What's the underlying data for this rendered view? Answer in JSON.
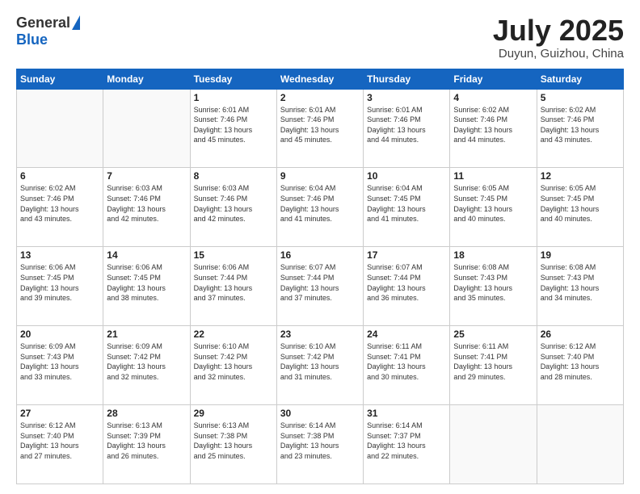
{
  "header": {
    "logo_general": "General",
    "logo_blue": "Blue",
    "title": "July 2025",
    "location": "Duyun, Guizhou, China"
  },
  "weekdays": [
    "Sunday",
    "Monday",
    "Tuesday",
    "Wednesday",
    "Thursday",
    "Friday",
    "Saturday"
  ],
  "weeks": [
    [
      {
        "day": "",
        "info": ""
      },
      {
        "day": "",
        "info": ""
      },
      {
        "day": "1",
        "info": "Sunrise: 6:01 AM\nSunset: 7:46 PM\nDaylight: 13 hours\nand 45 minutes."
      },
      {
        "day": "2",
        "info": "Sunrise: 6:01 AM\nSunset: 7:46 PM\nDaylight: 13 hours\nand 45 minutes."
      },
      {
        "day": "3",
        "info": "Sunrise: 6:01 AM\nSunset: 7:46 PM\nDaylight: 13 hours\nand 44 minutes."
      },
      {
        "day": "4",
        "info": "Sunrise: 6:02 AM\nSunset: 7:46 PM\nDaylight: 13 hours\nand 44 minutes."
      },
      {
        "day": "5",
        "info": "Sunrise: 6:02 AM\nSunset: 7:46 PM\nDaylight: 13 hours\nand 43 minutes."
      }
    ],
    [
      {
        "day": "6",
        "info": "Sunrise: 6:02 AM\nSunset: 7:46 PM\nDaylight: 13 hours\nand 43 minutes."
      },
      {
        "day": "7",
        "info": "Sunrise: 6:03 AM\nSunset: 7:46 PM\nDaylight: 13 hours\nand 42 minutes."
      },
      {
        "day": "8",
        "info": "Sunrise: 6:03 AM\nSunset: 7:46 PM\nDaylight: 13 hours\nand 42 minutes."
      },
      {
        "day": "9",
        "info": "Sunrise: 6:04 AM\nSunset: 7:46 PM\nDaylight: 13 hours\nand 41 minutes."
      },
      {
        "day": "10",
        "info": "Sunrise: 6:04 AM\nSunset: 7:45 PM\nDaylight: 13 hours\nand 41 minutes."
      },
      {
        "day": "11",
        "info": "Sunrise: 6:05 AM\nSunset: 7:45 PM\nDaylight: 13 hours\nand 40 minutes."
      },
      {
        "day": "12",
        "info": "Sunrise: 6:05 AM\nSunset: 7:45 PM\nDaylight: 13 hours\nand 40 minutes."
      }
    ],
    [
      {
        "day": "13",
        "info": "Sunrise: 6:06 AM\nSunset: 7:45 PM\nDaylight: 13 hours\nand 39 minutes."
      },
      {
        "day": "14",
        "info": "Sunrise: 6:06 AM\nSunset: 7:45 PM\nDaylight: 13 hours\nand 38 minutes."
      },
      {
        "day": "15",
        "info": "Sunrise: 6:06 AM\nSunset: 7:44 PM\nDaylight: 13 hours\nand 37 minutes."
      },
      {
        "day": "16",
        "info": "Sunrise: 6:07 AM\nSunset: 7:44 PM\nDaylight: 13 hours\nand 37 minutes."
      },
      {
        "day": "17",
        "info": "Sunrise: 6:07 AM\nSunset: 7:44 PM\nDaylight: 13 hours\nand 36 minutes."
      },
      {
        "day": "18",
        "info": "Sunrise: 6:08 AM\nSunset: 7:43 PM\nDaylight: 13 hours\nand 35 minutes."
      },
      {
        "day": "19",
        "info": "Sunrise: 6:08 AM\nSunset: 7:43 PM\nDaylight: 13 hours\nand 34 minutes."
      }
    ],
    [
      {
        "day": "20",
        "info": "Sunrise: 6:09 AM\nSunset: 7:43 PM\nDaylight: 13 hours\nand 33 minutes."
      },
      {
        "day": "21",
        "info": "Sunrise: 6:09 AM\nSunset: 7:42 PM\nDaylight: 13 hours\nand 32 minutes."
      },
      {
        "day": "22",
        "info": "Sunrise: 6:10 AM\nSunset: 7:42 PM\nDaylight: 13 hours\nand 32 minutes."
      },
      {
        "day": "23",
        "info": "Sunrise: 6:10 AM\nSunset: 7:42 PM\nDaylight: 13 hours\nand 31 minutes."
      },
      {
        "day": "24",
        "info": "Sunrise: 6:11 AM\nSunset: 7:41 PM\nDaylight: 13 hours\nand 30 minutes."
      },
      {
        "day": "25",
        "info": "Sunrise: 6:11 AM\nSunset: 7:41 PM\nDaylight: 13 hours\nand 29 minutes."
      },
      {
        "day": "26",
        "info": "Sunrise: 6:12 AM\nSunset: 7:40 PM\nDaylight: 13 hours\nand 28 minutes."
      }
    ],
    [
      {
        "day": "27",
        "info": "Sunrise: 6:12 AM\nSunset: 7:40 PM\nDaylight: 13 hours\nand 27 minutes."
      },
      {
        "day": "28",
        "info": "Sunrise: 6:13 AM\nSunset: 7:39 PM\nDaylight: 13 hours\nand 26 minutes."
      },
      {
        "day": "29",
        "info": "Sunrise: 6:13 AM\nSunset: 7:38 PM\nDaylight: 13 hours\nand 25 minutes."
      },
      {
        "day": "30",
        "info": "Sunrise: 6:14 AM\nSunset: 7:38 PM\nDaylight: 13 hours\nand 23 minutes."
      },
      {
        "day": "31",
        "info": "Sunrise: 6:14 AM\nSunset: 7:37 PM\nDaylight: 13 hours\nand 22 minutes."
      },
      {
        "day": "",
        "info": ""
      },
      {
        "day": "",
        "info": ""
      }
    ]
  ]
}
